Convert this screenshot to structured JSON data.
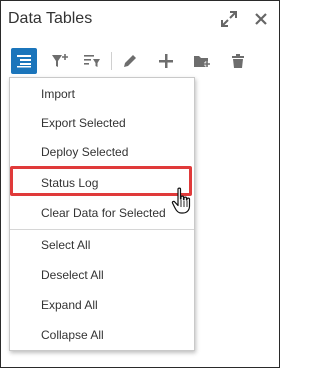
{
  "title": "Data Tables",
  "menu": {
    "items": [
      {
        "label": "Import"
      },
      {
        "label": "Export Selected"
      },
      {
        "label": "Deploy Selected"
      },
      {
        "label": "Status Log"
      },
      {
        "label": "Clear Data for Selected"
      },
      {
        "label": "Select All"
      },
      {
        "label": "Deselect All"
      },
      {
        "label": "Expand All"
      },
      {
        "label": "Collapse All"
      }
    ]
  },
  "toolbar": {
    "icons": [
      "menu-icon",
      "filter-add-icon",
      "filter-list-icon",
      "pencil-icon",
      "plus-icon",
      "folder-add-icon",
      "trash-icon"
    ]
  },
  "colors": {
    "accent": "#1b75bb",
    "highlight": "#e03a3a"
  }
}
